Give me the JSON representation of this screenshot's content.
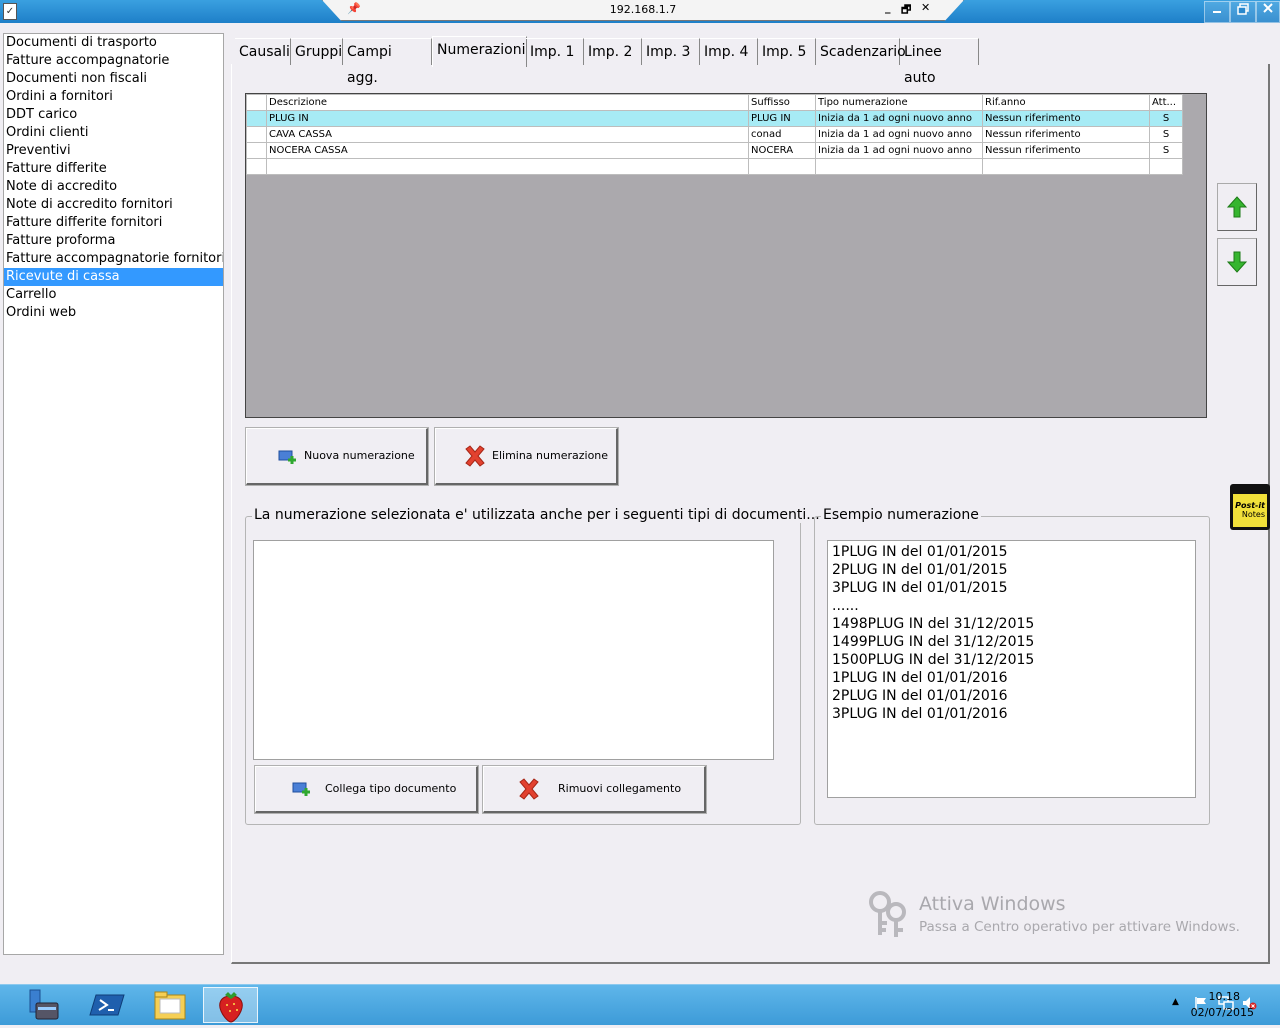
{
  "window": {
    "host": "192.168.1.7",
    "rdp_controls": {
      "minimize": "_",
      "restore": "🗗",
      "close": "✕"
    }
  },
  "doc_types": [
    "Documenti di trasporto",
    "Fatture accompagnatorie",
    "Documenti non fiscali",
    "Ordini a fornitori",
    "DDT carico",
    "Ordini clienti",
    "Preventivi",
    "Fatture differite",
    "Note di accredito",
    "Note di accredito fornitori",
    "Fatture differite fornitori",
    "Fatture proforma",
    "Fatture accompagnatorie fornitori",
    "Ricevute di cassa",
    "Carrello",
    "Ordini web"
  ],
  "selected_doc_type": "Ricevute di cassa",
  "tabs": [
    "Causali",
    "Gruppi",
    "Campi agg.",
    "Numerazioni",
    "Imp. 1",
    "Imp. 2",
    "Imp. 3",
    "Imp. 4",
    "Imp. 5",
    "Scadenzario",
    "Linee auto"
  ],
  "active_tab": "Numerazioni",
  "grid": {
    "columns": [
      "Descrizione",
      "Suffisso",
      "Tipo numerazione",
      "Rif.anno",
      "Att..."
    ],
    "rows": [
      [
        "PLUG IN",
        "PLUG IN",
        "Inizia da 1 ad ogni nuovo anno",
        "Nessun riferimento",
        "S"
      ],
      [
        "CAVA CASSA",
        "conad",
        "Inizia da 1 ad ogni nuovo anno",
        "Nessun riferimento",
        "S"
      ],
      [
        "NOCERA CASSA",
        "NOCERA",
        "Inizia da 1 ad ogni nuovo anno",
        "Nessun riferimento",
        "S"
      ]
    ],
    "selected_row": 0
  },
  "buttons": {
    "new_numbering": "Nuova numerazione",
    "delete_numbering": "Elimina numerazione",
    "link_doc_type": "Collega tipo documento",
    "remove_link": "Rimuovi collegamento"
  },
  "linked_group": {
    "title": "La numerazione selezionata e' utilizzata anche per i seguenti tipi di documenti...",
    "items": []
  },
  "example_group": {
    "title": "Esempio numerazione",
    "lines": [
      "1PLUG IN del 01/01/2015",
      "2PLUG IN del 01/01/2015",
      "3PLUG IN del 01/01/2015",
      "......",
      "1498PLUG IN del 31/12/2015",
      "1499PLUG IN del 31/12/2015",
      "1500PLUG IN del 31/12/2015",
      "1PLUG IN del 01/01/2016",
      "2PLUG IN del 01/01/2016",
      "3PLUG IN del 01/01/2016"
    ]
  },
  "watermark": {
    "title": "Attiva Windows",
    "subtitle": "Passa a Centro operativo per attivare Windows."
  },
  "postit": {
    "line1": "Post-it",
    "line2": "Notes"
  },
  "taskbar": {
    "time": "10.18",
    "date": "02/07/2015"
  },
  "colors": {
    "selection": "#3399ff",
    "grid_selected_row": "#a7ebf5",
    "arrow_green": "#36b52f",
    "delete_red": "#e2412f",
    "taskbar": "#4aa8e0"
  }
}
